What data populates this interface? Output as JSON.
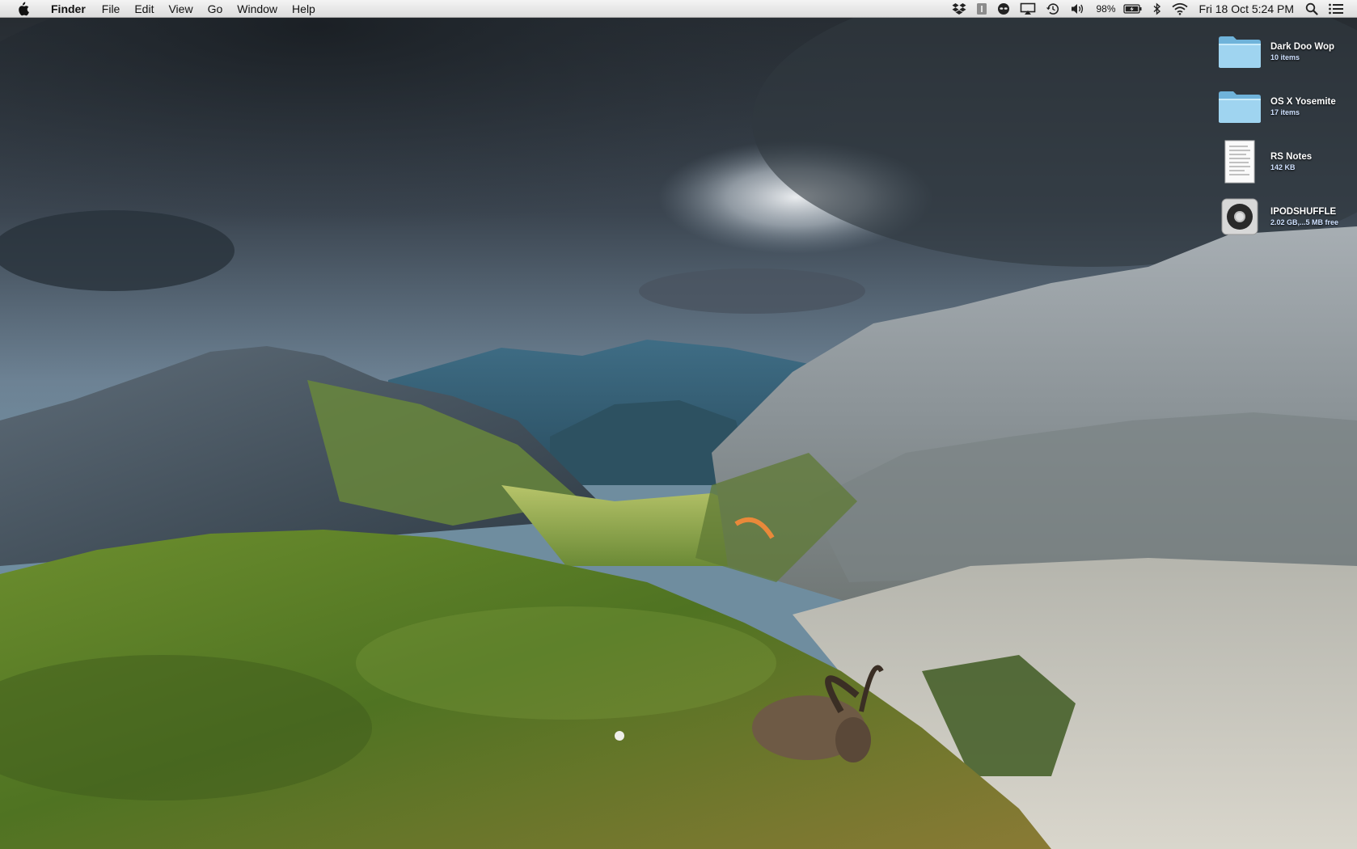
{
  "menubar": {
    "apple_icon": "apple-icon",
    "app_name": "Finder",
    "menus": [
      "File",
      "Edit",
      "View",
      "Go",
      "Window",
      "Help"
    ],
    "status_icons": [
      "dropbox-icon",
      "text-input-icon",
      "alien-icon",
      "airplay-icon",
      "time-machine-icon",
      "volume-icon"
    ],
    "battery_percent": "98%",
    "battery_icon": "battery-charging-icon",
    "bluetooth_icon": "bluetooth-icon",
    "wifi_icon": "wifi-icon",
    "clock": "Fri 18 Oct  5:24 PM",
    "spotlight_icon": "spotlight-search-icon",
    "notification_icon": "notification-center-icon"
  },
  "desktop": {
    "items": [
      {
        "name": "Dark Doo Wop",
        "info": "10 items",
        "icon": "folder-icon"
      },
      {
        "name": "OS X Yosemite",
        "info": "17 items",
        "icon": "folder-icon"
      },
      {
        "name": "RS Notes",
        "info": "142 KB",
        "icon": "document-icon"
      },
      {
        "name": "IPODSHUFFLE",
        "info": "2.02 GB,...5 MB free",
        "icon": "ipod-shuffle-icon"
      }
    ]
  }
}
